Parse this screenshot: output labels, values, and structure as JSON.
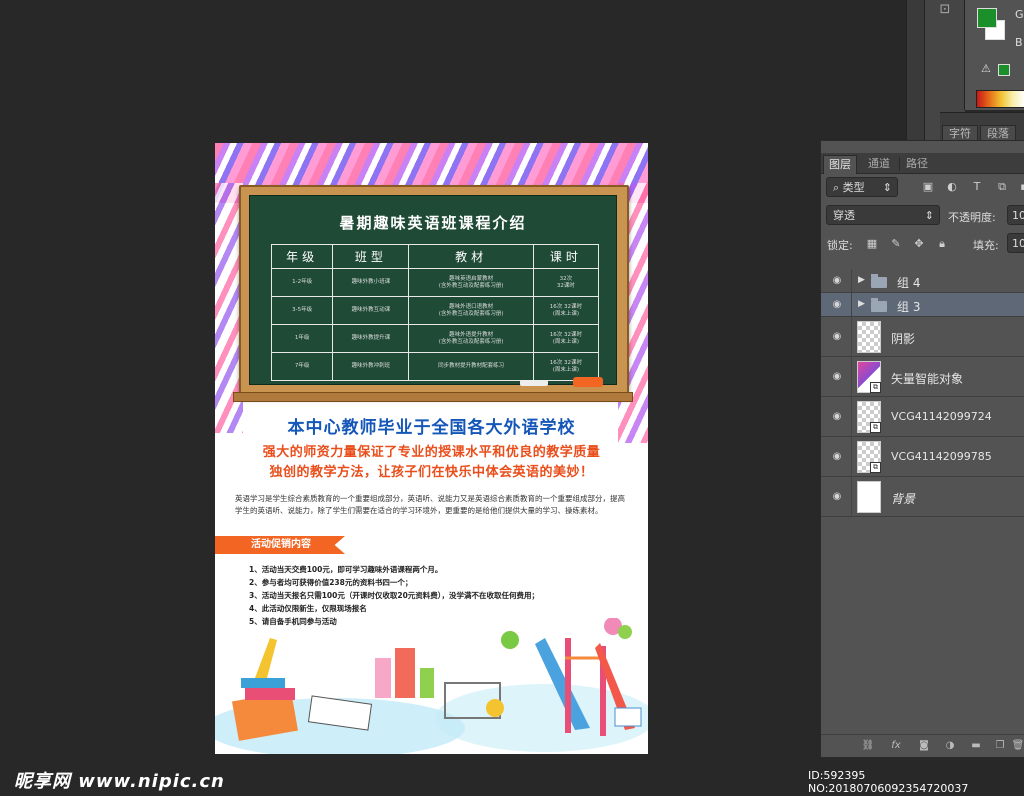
{
  "swatches": {
    "foreground": "#1a8f2a",
    "background": "#ffffff",
    "accent_small": "#1a8f2a"
  },
  "color_panel": {
    "label_g": "G",
    "label_b": "B"
  },
  "char_tabs": [
    "字符",
    "段落"
  ],
  "layers_panel": {
    "tabs": [
      "图层",
      "通道",
      "路径"
    ],
    "filter_label": "类型",
    "blend_mode": "穿透",
    "opacity_label": "不透明度:",
    "opacity_value": "10",
    "lock_label": "锁定:",
    "fill_label": "填充:",
    "fill_value": "10",
    "layers": [
      {
        "name": "组 4",
        "kind": "group"
      },
      {
        "name": "组 3",
        "kind": "group",
        "selected": true
      },
      {
        "name": "阴影",
        "kind": "layer"
      },
      {
        "name": "矢量智能对象",
        "kind": "smart"
      },
      {
        "name": "VCG41142099724",
        "kind": "smart"
      },
      {
        "name": "VCG41142099785",
        "kind": "smart"
      },
      {
        "name": "背景",
        "kind": "background"
      }
    ]
  },
  "flyer": {
    "board_title": "暑期趣味英语班课程介绍",
    "table": {
      "headers": [
        "年级",
        "班型",
        "教材",
        "课时"
      ],
      "rows": [
        [
          "1-2年级",
          "趣味外教小班课",
          "趣味英语启蒙教材\n(含外教互动及配套练习册)",
          "32次\n32课时"
        ],
        [
          "3-5年级",
          "趣味外教互动课",
          "趣味外语口语教材\n(含外教互动及配套练习册)",
          "16次 32课时\n(周末上课)"
        ],
        [
          "1年级",
          "趣味外教提升课",
          "趣味外语提升教材\n(含外教互动及配套练习册)",
          "16次 32课时\n(周末上课)"
        ],
        [
          "7年级",
          "趣味外教冲刺班",
          "同步教材提升教材配套练习",
          "16次 32课时\n(周末上课)"
        ]
      ]
    },
    "headline": "本中心教师毕业于全国各大外语学校",
    "subline1": "强大的师资力量保证了专业的授课水平和优良的教学质量",
    "subline2": "独创的教学方法，让孩子们在快乐中体会英语的美妙！",
    "intro": "英语学习是学生综合素质教育的一个重要组成部分，英语听、说能力又是英语综合素质教育的一个重要组成部分，提高学生的英语听、说能力，除了学生们需要在适合的学习环境外，更重要的是给他们提供大量的学习、操练素材。",
    "promo_title": "活动促销内容",
    "promo_items": [
      "1、活动当天交费100元，即可学习趣味外语课程两个月。",
      "2、参与者均可获得价值238元的资料书四一个；",
      "3、活动当天报名只需100元（开课时仅收取20元资料费），没学满不在收取任何费用；",
      "4、此活动仅限新生，仅限现场报名",
      "5、请自备手机同参与活动"
    ]
  },
  "watermark": {
    "logo": "昵享网 www.nipic.cn",
    "id": "ID:592395 NO:20180706092354720037"
  }
}
